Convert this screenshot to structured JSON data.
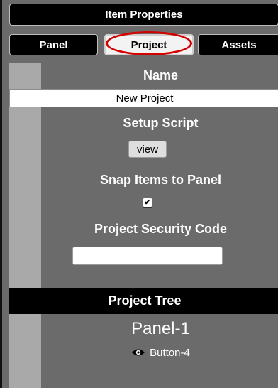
{
  "header": {
    "title": "Item Properties"
  },
  "tabs": [
    {
      "label": "Panel"
    },
    {
      "label": "Project",
      "selected": true
    },
    {
      "label": "Assets"
    }
  ],
  "project": {
    "name_label": "Name",
    "name_value": "New Project",
    "setup_label": "Setup Script",
    "view_button": "view",
    "snap_label": "Snap Items to Panel",
    "snap_checked": true,
    "checkbox_mark": "✔",
    "security_label": "Project Security Code",
    "security_value": ""
  },
  "tree": {
    "title": "Project Tree",
    "panel": "Panel-1",
    "children": [
      {
        "label": "Button-4",
        "icon": "eye-icon"
      }
    ]
  },
  "colors": {
    "background": "#6b6b6b",
    "strip": "#a9a9a9",
    "highlight": "#d40000"
  }
}
